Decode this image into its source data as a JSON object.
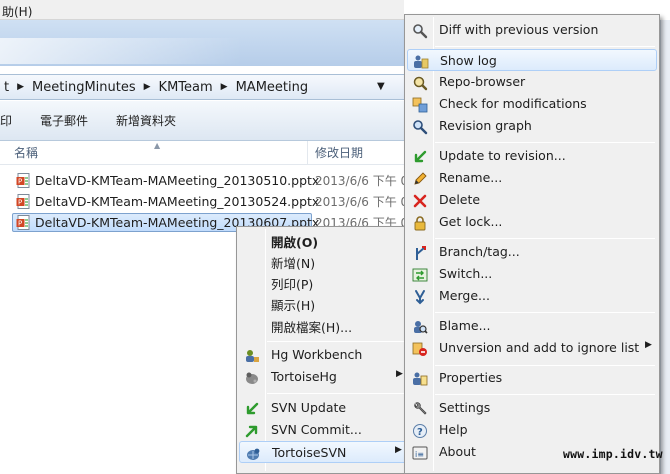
{
  "menubar": {
    "visible_fragment": "助(H)"
  },
  "breadcrumb": [
    "t",
    "MeetingMinutes",
    "KMTeam",
    "MAMeeting"
  ],
  "toolbar": {
    "items": [
      "印",
      "電子郵件",
      "新增資料夾"
    ]
  },
  "columns": {
    "name": "名稱",
    "date": "修改日期"
  },
  "files": [
    {
      "name": "DeltaVD-KMTeam-MAMeeting_20130510.pptx",
      "date": "2013/6/6 下午 0",
      "selected": false
    },
    {
      "name": "DeltaVD-KMTeam-MAMeeting_20130524.pptx",
      "date": "2013/6/6 下午 0",
      "selected": false
    },
    {
      "name": "DeltaVD-KMTeam-MAMeeting_20130607.pptx",
      "date": "2013/6/6 下午 0",
      "selected": true
    }
  ],
  "context_menu": {
    "open": "開啟(O)",
    "new": "新增(N)",
    "print": "列印(P)",
    "show": "顯示(H)",
    "open_location": "開啟檔案(H)...",
    "hg_workbench": "Hg Workbench",
    "tortoisehg": "TortoiseHg",
    "svn_update": "SVN Update",
    "svn_commit": "SVN Commit...",
    "tortoisesvn": "TortoiseSVN"
  },
  "svn_menu": {
    "diff_prev": "Diff with previous version",
    "show_log": "Show log",
    "repo_browser": "Repo-browser",
    "check_mods": "Check for modifications",
    "revision_graph": "Revision graph",
    "update_to_rev": "Update to revision...",
    "rename": "Rename...",
    "delete": "Delete",
    "get_lock": "Get lock...",
    "branch_tag": "Branch/tag...",
    "switch": "Switch...",
    "merge": "Merge...",
    "blame": "Blame...",
    "unversion": "Unversion and add to ignore list",
    "properties": "Properties",
    "settings": "Settings",
    "help": "Help",
    "about": "About"
  },
  "watermark": "www.imp.idv.tw",
  "colors": {
    "highlight_border": "#aecff7",
    "selection_fill": "#c1dcfc",
    "menu_bg": "#f0f0f0"
  }
}
